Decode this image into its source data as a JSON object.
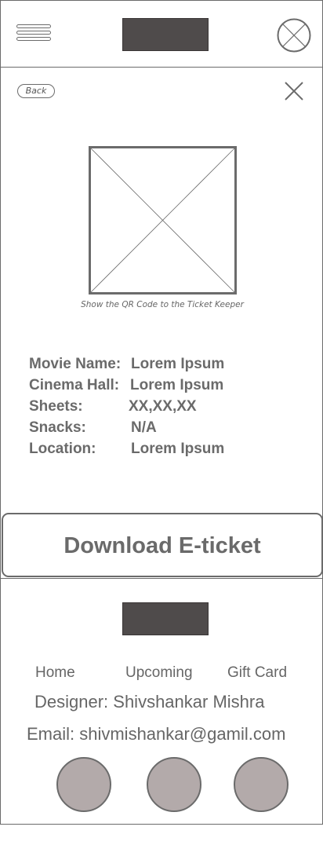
{
  "header": {
    "menu_icon": "hamburger-menu-icon",
    "logo": "logo-placeholder",
    "close_icon": "circle-x-icon"
  },
  "ticket": {
    "back_label": "Back",
    "close_icon": "x-icon",
    "qr_icon": "image-placeholder-icon",
    "qr_caption": "Show the QR Code to the Ticket Keeper",
    "details": [
      {
        "label": "Movie Name:",
        "value": "Lorem Ipsum"
      },
      {
        "label": "Cinema Hall:",
        "value": "Lorem Ipsum"
      },
      {
        "label": "Sheets:",
        "value": "XX,XX,XX"
      },
      {
        "label": "Snacks:",
        "value": "N/A"
      },
      {
        "label": "Location:",
        "value": "Lorem Ipsum"
      }
    ],
    "download_label": "Download E-ticket"
  },
  "footer": {
    "nav": [
      "Home",
      "Upcoming",
      "Gift Card"
    ],
    "designer": "Designer: Shivshankar Mishra",
    "email": "Email: shivmishankar@gamil.com",
    "social_icons": [
      "social-icon-1",
      "social-icon-2",
      "social-icon-3"
    ],
    "colors": {
      "logo": "#4f4b4b",
      "social": "#b3aaaa",
      "border": "#6b6b6b"
    }
  }
}
